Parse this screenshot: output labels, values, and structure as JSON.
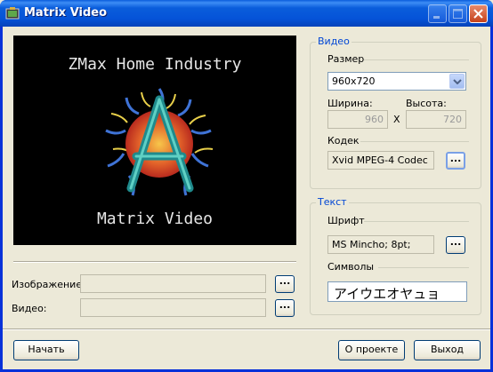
{
  "window": {
    "title": "Matrix Video"
  },
  "preview": {
    "top_text": "ZMax Home Industry",
    "bottom_text": "Matrix Video"
  },
  "files": {
    "image_label": "Изображение:",
    "image_value": "",
    "video_label": "Видео:",
    "video_value": "",
    "browse_label": "..."
  },
  "video_group": {
    "title": "Видео",
    "size_label": "Размер",
    "size_value": "960x720",
    "width_label": "Ширина:",
    "height_label": "Высота:",
    "width_value": "960",
    "height_value": "720",
    "x_sep": "X",
    "codec_label": "Кодек",
    "codec_value": "Xvid MPEG-4 Codec",
    "browse_label": "..."
  },
  "text_group": {
    "title": "Текст",
    "font_label": "Шрифт",
    "font_value": "MS Mincho; 8pt;",
    "browse_label": "...",
    "symbols_label": "Символы",
    "symbols_value": "アイウエオヤュョ"
  },
  "buttons": {
    "start": "Начать",
    "about": "О проекте",
    "exit": "Выход"
  },
  "colors": {
    "titlebar": "#0a5ddb",
    "group_title": "#0046d5",
    "window_bg": "#ece9d8"
  }
}
